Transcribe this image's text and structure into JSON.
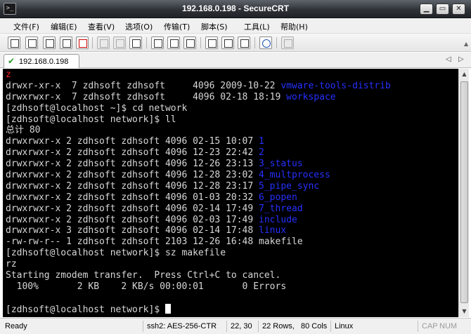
{
  "window": {
    "title": "192.168.0.198 - SecureCRT",
    "app_icon": "terminal-icon",
    "controls": {
      "minimize": "▁",
      "maximize": "▭",
      "close": "✕"
    }
  },
  "menu": [
    "文件(F)",
    "编辑(E)",
    "查看(V)",
    "选项(O)",
    "传输(T)",
    "脚本(S)",
    "工具(L)",
    "帮助(H)"
  ],
  "toolbar_icons": [
    "connect-icon",
    "quick-connect-icon",
    "connect-tab-icon",
    "reconnect-icon",
    "disconnect-icon",
    "copy-icon",
    "paste-icon",
    "find-icon",
    "print-icon",
    "print-selection-icon",
    "print-setup-icon",
    "session-options-icon",
    "global-options-icon",
    "keymap-icon",
    "help-icon",
    "sftp-icon"
  ],
  "tab": {
    "label": "192.168.0.198",
    "status_icon": "connected-check-icon"
  },
  "terminal_lines": [
    [
      {
        "t": "z",
        "c": "red"
      }
    ],
    [
      {
        "t": "drwxr-xr-x  7 zdhsoft zdhsoft     4096 2009-10-22 ",
        "c": "gray"
      },
      {
        "t": "vmware-tools-distrib",
        "c": "blue"
      }
    ],
    [
      {
        "t": "drwxrwxr-x  7 zdhsoft zdhsoft     4096 02-18 18:19 ",
        "c": "gray"
      },
      {
        "t": "workspace",
        "c": "blue"
      }
    ],
    [
      {
        "t": "[zdhsoft@localhost ~]$ cd network",
        "c": "gray"
      }
    ],
    [
      {
        "t": "[zdhsoft@localhost network]$ ll",
        "c": "gray"
      }
    ],
    [
      {
        "t": "总计 80",
        "c": "gray"
      }
    ],
    [
      {
        "t": "drwxrwxr-x 2 zdhsoft zdhsoft 4096 02-15 10:07 ",
        "c": "gray"
      },
      {
        "t": "1",
        "c": "blue"
      }
    ],
    [
      {
        "t": "drwxrwxr-x 2 zdhsoft zdhsoft 4096 12-23 22:42 ",
        "c": "gray"
      },
      {
        "t": "2",
        "c": "blue"
      }
    ],
    [
      {
        "t": "drwxrwxr-x 2 zdhsoft zdhsoft 4096 12-26 23:13 ",
        "c": "gray"
      },
      {
        "t": "3_status",
        "c": "blue"
      }
    ],
    [
      {
        "t": "drwxrwxr-x 2 zdhsoft zdhsoft 4096 12-28 23:02 ",
        "c": "gray"
      },
      {
        "t": "4_multprocess",
        "c": "blue"
      }
    ],
    [
      {
        "t": "drwxrwxr-x 2 zdhsoft zdhsoft 4096 12-28 23:17 ",
        "c": "gray"
      },
      {
        "t": "5_pipe_sync",
        "c": "blue"
      }
    ],
    [
      {
        "t": "drwxrwxr-x 2 zdhsoft zdhsoft 4096 01-03 20:32 ",
        "c": "gray"
      },
      {
        "t": "6_popen",
        "c": "blue"
      }
    ],
    [
      {
        "t": "drwxrwxr-x 2 zdhsoft zdhsoft 4096 02-14 17:49 ",
        "c": "gray"
      },
      {
        "t": "7_thread",
        "c": "blue"
      }
    ],
    [
      {
        "t": "drwxrwxr-x 2 zdhsoft zdhsoft 4096 02-03 17:49 ",
        "c": "gray"
      },
      {
        "t": "include",
        "c": "blue"
      }
    ],
    [
      {
        "t": "drwxrwxr-x 3 zdhsoft zdhsoft 4096 02-14 17:48 ",
        "c": "gray"
      },
      {
        "t": "linux",
        "c": "blue"
      }
    ],
    [
      {
        "t": "-rw-rw-r-- 1 zdhsoft zdhsoft 2103 12-26 16:48 makefile",
        "c": "gray"
      }
    ],
    [
      {
        "t": "[zdhsoft@localhost network]$ sz makefile",
        "c": "gray"
      }
    ],
    [
      {
        "t": "rz",
        "c": "gray"
      }
    ],
    [
      {
        "t": "Starting zmodem transfer.  Press Ctrl+C to cancel.",
        "c": "gray"
      }
    ],
    [
      {
        "t": "  100%       2 KB    2 KB/s 00:00:01       0 Errors",
        "c": "gray"
      }
    ],
    [
      {
        "t": "",
        "c": "gray"
      }
    ],
    [
      {
        "t": "[zdhsoft@localhost network]$ ",
        "c": "gray"
      }
    ]
  ],
  "status": {
    "ready": "Ready",
    "cipher": "ssh2: AES-256-CTR",
    "cursor": "22,  30",
    "rows": "22 Rows,",
    "cols": "80 Cols",
    "terminal_type": "Linux",
    "cap": "CAP",
    "num": "NUM"
  },
  "colors": {
    "terminal_bg": "#000000",
    "text": "#d7d7d7",
    "directory": "#2530ff",
    "highlight": "#ff2020"
  }
}
